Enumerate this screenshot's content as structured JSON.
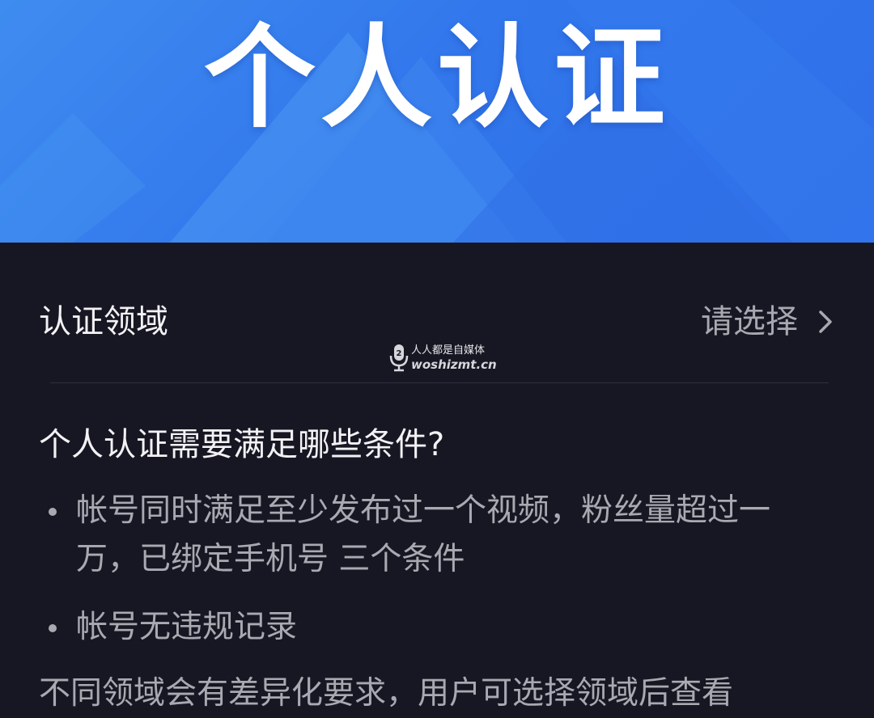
{
  "banner": {
    "title": "个人认证"
  },
  "certification_field": {
    "label": "认证领域",
    "value": "请选择"
  },
  "watermark": {
    "line1": "人人都是自媒体",
    "line2": "woshizmt.cn"
  },
  "requirements": {
    "title": "个人认证需要满足哪些条件?",
    "items": [
      "帐号同时满足至少发布过一个视频，粉丝量超过一万，已绑定手机号 三个条件",
      "帐号无违规记录"
    ],
    "note": "不同领域会有差异化要求，用户可选择领域后查看"
  },
  "colors": {
    "banner_blue": "#3277ec",
    "background": "#171723",
    "primary_text": "#f2f2f5",
    "secondary_text": "#a9a9b1"
  },
  "icons": {
    "chevron": "chevron-right-icon",
    "watermark": "microphone-logo-icon"
  }
}
